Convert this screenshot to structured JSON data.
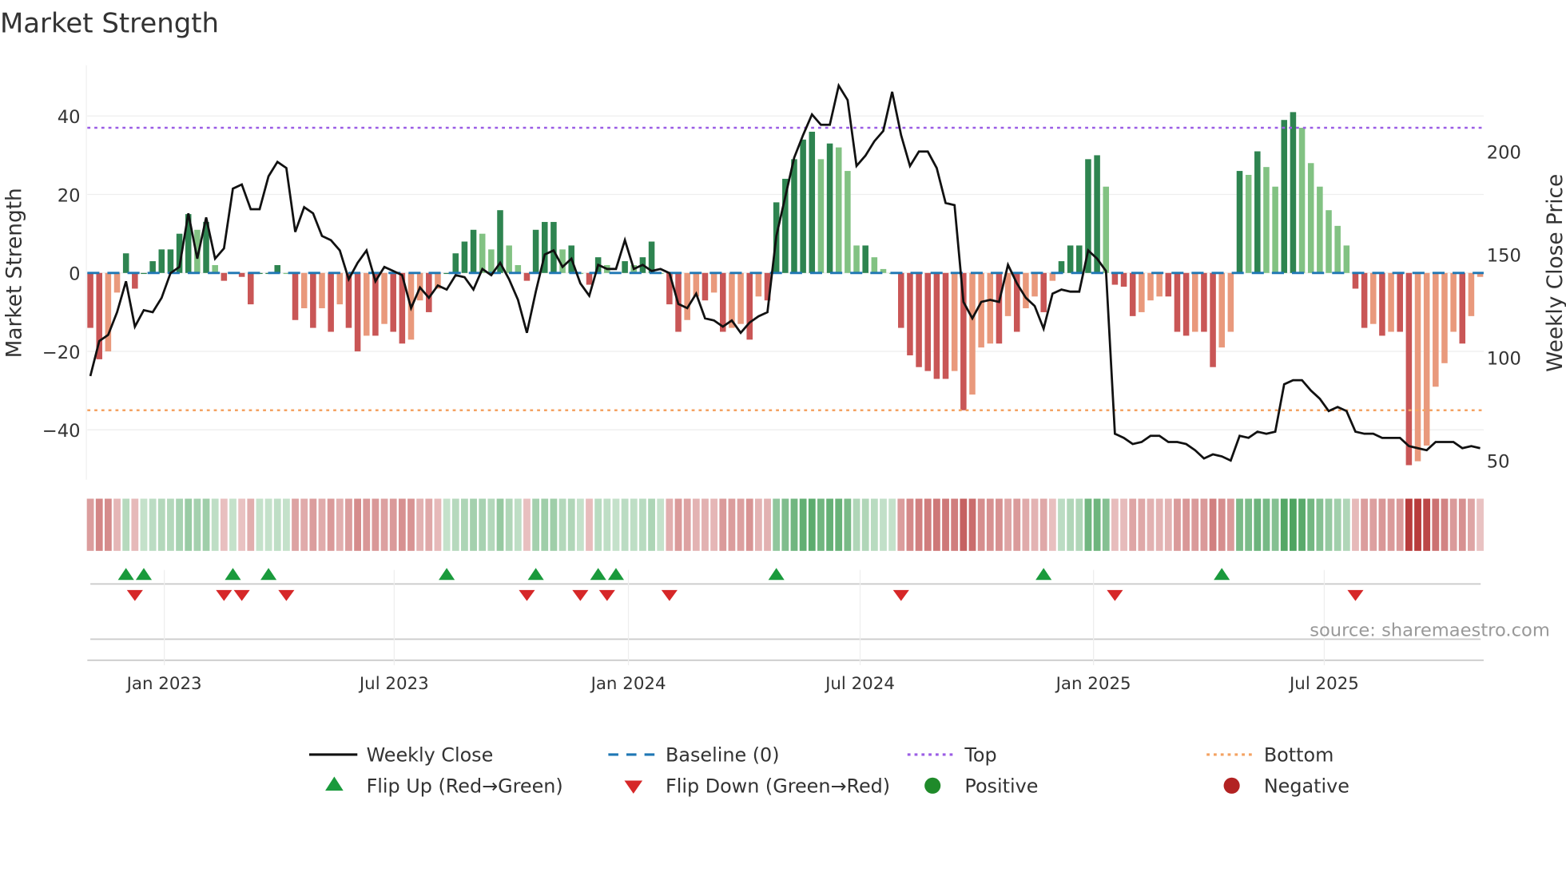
{
  "chart_data": {
    "type": "bar",
    "title": "Market Strength",
    "ylabel": "Market Strength",
    "y2label": "Weekly Close Price",
    "ylim": [
      -53,
      53
    ],
    "y2lim": [
      45,
      232
    ],
    "yticks": [
      40,
      20,
      0,
      -20,
      -40
    ],
    "ytick_labels": [
      "40",
      "20",
      "0",
      "−20",
      "−40"
    ],
    "y2ticks": [
      200,
      150,
      100,
      50
    ],
    "x_unit": "week index",
    "xticks": [
      {
        "week": 8.3,
        "label": "Jan 2023"
      },
      {
        "week": 34.1,
        "label": "Jul 2023"
      },
      {
        "week": 60.4,
        "label": "Jan 2024"
      },
      {
        "week": 86.4,
        "label": "Jul 2024"
      },
      {
        "week": 112.6,
        "label": "Jan 2025"
      },
      {
        "week": 138.5,
        "label": "Jul 2025"
      }
    ],
    "top_level": 37,
    "bottom_level": -35,
    "baseline": 0,
    "strength": [
      -14,
      -22,
      -20,
      -5,
      5,
      -4,
      0,
      3,
      6,
      6,
      10,
      15,
      11,
      13,
      2,
      -2,
      0,
      -1,
      -8,
      0,
      0,
      2,
      0,
      -12,
      -9,
      -14,
      -9,
      -15,
      -8,
      -14,
      -20,
      -16,
      -16,
      -13,
      -15,
      -18,
      -17,
      -7,
      -10,
      -4,
      0,
      5,
      8,
      11,
      10,
      6,
      16,
      7,
      2,
      -2,
      11,
      13,
      13,
      6,
      7,
      0,
      -3,
      4,
      2,
      0,
      3,
      2,
      4,
      8,
      0,
      -8,
      -15,
      -12,
      -6,
      -7,
      -5,
      -15,
      -14,
      -13,
      -17,
      -6,
      -7,
      18,
      24,
      29,
      34,
      36,
      29,
      33,
      32,
      26,
      7,
      7,
      4,
      1,
      0,
      -14,
      -21,
      -24,
      -25,
      -27,
      -27,
      -25,
      -35,
      -31,
      -19,
      -18,
      -18,
      -11,
      -15,
      -9,
      -6,
      -10,
      -2,
      3,
      7,
      7,
      29,
      30,
      22,
      -3,
      -3.5,
      -11,
      -10,
      -7,
      -6,
      -6,
      -15,
      -16,
      -15,
      -15,
      -24,
      -19,
      -15,
      26,
      25,
      31,
      27,
      22,
      39,
      41,
      37,
      28,
      22,
      16,
      12,
      7,
      -4,
      -14,
      -13,
      -16,
      -15,
      -15,
      -49,
      -48,
      -44,
      -29,
      -23,
      -15,
      -18,
      -11,
      -1
    ],
    "close": [
      91,
      108,
      111,
      122,
      137,
      115,
      123,
      122,
      129,
      141,
      144,
      170,
      148,
      168,
      148,
      153,
      182,
      184,
      172,
      172,
      188,
      195,
      192,
      161,
      173,
      170,
      159,
      157,
      152,
      138,
      146,
      152,
      137,
      144,
      142,
      140,
      124,
      134,
      129,
      135,
      133,
      140,
      139,
      133,
      143,
      140,
      146,
      138,
      128,
      112,
      132,
      150,
      152,
      144,
      148,
      136,
      130,
      145,
      143,
      143,
      157,
      143,
      145,
      142,
      143,
      141,
      126,
      124,
      131,
      119,
      118,
      115,
      118,
      112,
      117,
      120,
      122,
      159,
      178,
      197,
      208,
      218,
      213,
      213,
      232,
      225,
      193,
      198,
      205,
      210,
      229,
      208,
      193,
      200,
      200,
      192,
      175,
      174,
      127,
      119,
      127,
      128,
      127,
      145,
      136,
      129,
      125,
      114,
      131,
      133,
      132,
      132,
      152,
      148,
      142,
      63,
      61,
      58,
      59,
      62,
      62,
      59,
      59,
      58,
      55,
      51,
      53,
      52,
      50,
      62,
      61,
      64,
      63,
      64,
      87,
      89,
      89,
      84,
      80,
      74,
      76,
      74,
      64,
      63,
      63,
      61,
      61,
      61,
      57,
      56,
      55,
      59,
      59,
      59,
      56,
      57,
      56
    ],
    "flip_up_weeks": [
      4,
      6,
      16,
      20,
      40,
      50,
      57,
      59,
      77,
      107,
      127
    ],
    "flip_down_weeks": [
      5,
      15,
      17,
      22,
      49,
      55,
      58,
      65,
      91,
      115,
      142
    ],
    "legend": [
      {
        "label": "Weekly Close",
        "marker": "solid-line",
        "color": "#111111"
      },
      {
        "label": "Baseline (0)",
        "marker": "dashed-line",
        "color": "#1f77b4"
      },
      {
        "label": "Top",
        "marker": "dotted-line",
        "color": "#9b5de5"
      },
      {
        "label": "Bottom",
        "marker": "dotted-line",
        "color": "#f4a261"
      },
      {
        "label": "Flip Up (Red→Green)",
        "marker": "triangle-up",
        "color": "#1a9a3c"
      },
      {
        "label": "Flip Down (Green→Red)",
        "marker": "triangle-down",
        "color": "#d62728"
      },
      {
        "label": "Positive",
        "marker": "circle",
        "color": "#1f8a2a"
      },
      {
        "label": "Negative",
        "marker": "circle",
        "color": "#b22222"
      }
    ],
    "legend_position": "bottom",
    "source": "source: sharemaestro.com"
  },
  "colors": {
    "pos_strong": "#2e8450",
    "pos_weak": "#82c283",
    "neg_strong": "#c95656",
    "neg_weak": "#e9997c"
  }
}
